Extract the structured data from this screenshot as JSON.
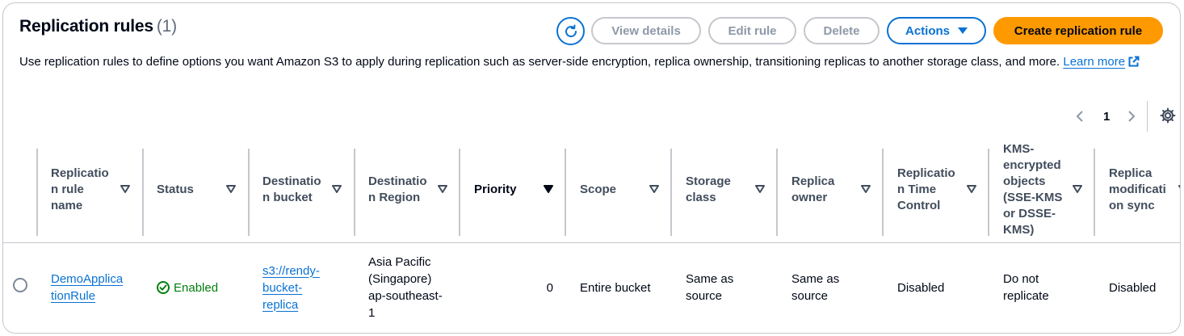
{
  "header": {
    "title": "Replication rules",
    "count": "(1)",
    "description": "Use replication rules to define options you want Amazon S3 to apply during replication such as server-side encryption, replica ownership, transitioning replicas to another storage class, and more.",
    "learn_more": "Learn more"
  },
  "toolbar": {
    "view_details": "View details",
    "edit_rule": "Edit rule",
    "delete": "Delete",
    "actions": "Actions",
    "create": "Create replication rule"
  },
  "pagination": {
    "current_page": "1"
  },
  "table": {
    "columns": [
      {
        "label": "Replicatio n rule name"
      },
      {
        "label": "Status"
      },
      {
        "label": "Destinatio n bucket"
      },
      {
        "label": "Destinatio n Region"
      },
      {
        "label": "Priority"
      },
      {
        "label": "Scope"
      },
      {
        "label": "Storage class"
      },
      {
        "label": "Replica owner"
      },
      {
        "label": "Replicatio n Time Control"
      },
      {
        "label": "KMS-encrypted objects (SSE-KMS or DSSE-KMS)"
      },
      {
        "label": "Replica modificati on sync"
      }
    ],
    "rows": [
      {
        "rule_name": "DemoApplica tionRule",
        "status": "Enabled",
        "destination_bucket": "s3://rendy-bucket-replica",
        "destination_region": "Asia Pacific (Singapore) ap-southeast-1",
        "priority": "0",
        "scope": "Entire bucket",
        "storage_class": "Same as source",
        "replica_owner": "Same as source",
        "rtc": "Disabled",
        "kms": "Do not replicate",
        "modification_sync": "Disabled"
      }
    ]
  },
  "colors": {
    "accent": "#0972d3",
    "primary": "#ff9900",
    "success": "#037f0c",
    "border": "#c6c6cd",
    "disabled_text": "#8d99a8"
  },
  "icons": [
    "refresh-icon",
    "external-link-icon",
    "chevron-left-icon",
    "chevron-right-icon",
    "settings-gear-icon",
    "caret-down-icon",
    "sort-icon",
    "check-circle-icon"
  ]
}
